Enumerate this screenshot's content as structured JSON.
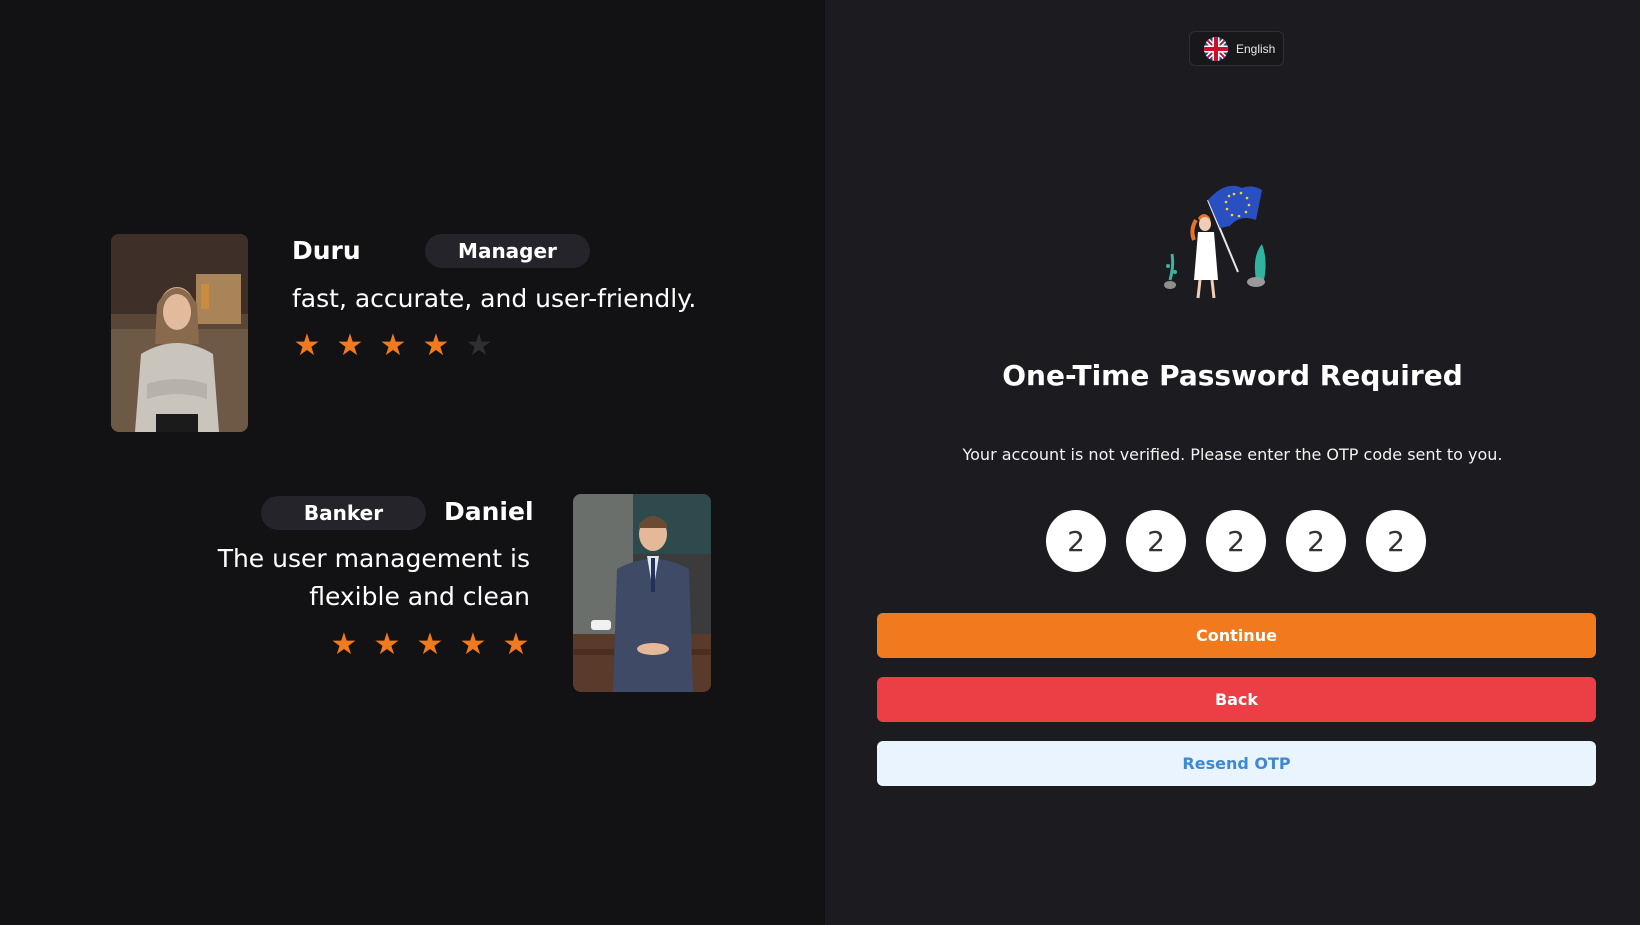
{
  "language": {
    "label": "English",
    "flag_icon": "uk-flag-icon"
  },
  "otp": {
    "title": "One-Time Password Required",
    "message": "Your account is not verified. Please enter the OTP code sent to you.",
    "digits": [
      "2",
      "2",
      "2",
      "2",
      "2"
    ],
    "continue_label": "Continue",
    "back_label": "Back",
    "resend_label": "Resend OTP"
  },
  "testimonials": [
    {
      "name": "Duru",
      "role": "Manager",
      "quote": "fast, accurate, and user-friendly.",
      "rating": 4,
      "max_rating": 5
    },
    {
      "name": "Daniel",
      "role": "Banker",
      "quote_line1": "The user management is",
      "quote_line2": "flexible and clean",
      "rating": 5,
      "max_rating": 5
    }
  ],
  "colors": {
    "accent": "#f07a1d",
    "danger": "#eb3e45",
    "info_bg": "#e9f4ff",
    "info_text": "#3f88d6"
  }
}
